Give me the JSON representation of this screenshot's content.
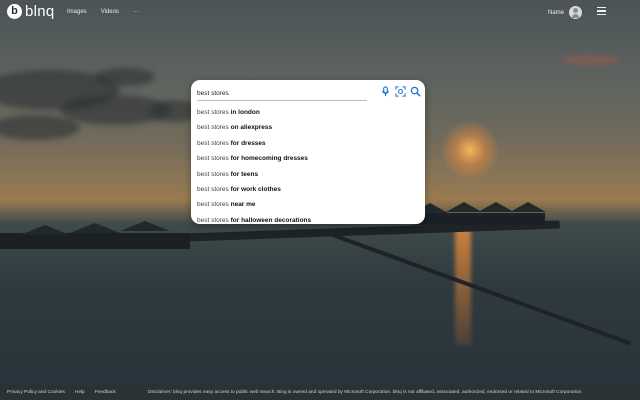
{
  "header": {
    "logo_mark": "b",
    "logo_text": "blnq",
    "nav": [
      "Images",
      "Videos",
      "···"
    ],
    "user_name": "Name"
  },
  "search": {
    "query": "best stores",
    "suggestions": [
      {
        "prefix": "best stores",
        "completion": " in london"
      },
      {
        "prefix": "best stores",
        "completion": " on aliexpress"
      },
      {
        "prefix": "best stores",
        "completion": " for dresses"
      },
      {
        "prefix": "best stores",
        "completion": " for homecoming dresses"
      },
      {
        "prefix": "best stores",
        "completion": " for teens"
      },
      {
        "prefix": "best stores",
        "completion": " for work clothes"
      },
      {
        "prefix": "best stores",
        "completion": " near me"
      },
      {
        "prefix": "best stores",
        "completion": " for halloween decorations"
      }
    ],
    "accent_color": "#1a73d9"
  },
  "footer": {
    "links": [
      "Privacy Policy and Cookies",
      "Help",
      "Feedback"
    ],
    "disclaimer": "Disclaimer: blnq provides easy access to public web search. Bing is owned and operated by Microsoft Corporation. blnq is not affiliated, associated, authorized, endorsed or related to Microsoft Corporation."
  }
}
